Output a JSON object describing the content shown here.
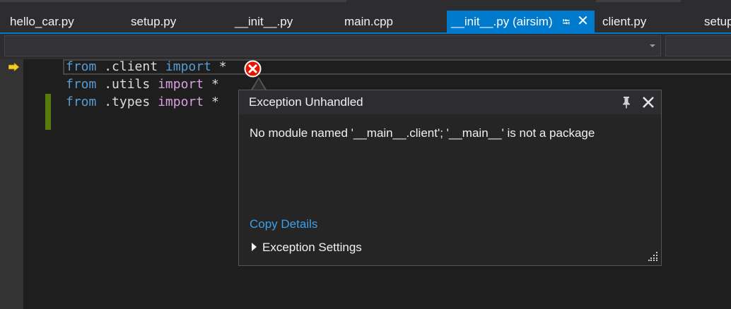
{
  "tabs": [
    {
      "label": "hello_car.py",
      "active": false
    },
    {
      "label": "setup.py",
      "active": false
    },
    {
      "label": "__init__.py",
      "active": false
    },
    {
      "label": "main.cpp",
      "active": false
    },
    {
      "label": "__init__.py (airsim)",
      "active": true
    },
    {
      "label": "client.py",
      "active": false
    },
    {
      "label": "setup.py",
      "active": false
    }
  ],
  "code": [
    {
      "keyword": "from",
      "module": ".client",
      "imp": "import",
      "rest": "*"
    },
    {
      "keyword": "from",
      "module": ".utils",
      "imp": "import",
      "rest": "*"
    },
    {
      "keyword": "from",
      "module": ".types",
      "imp": "import",
      "rest": "*"
    }
  ],
  "popup": {
    "title": "Exception Unhandled",
    "message": "No module named '__main__.client'; '__main__' is not a package",
    "copy_details": "Copy Details",
    "settings": "Exception Settings"
  },
  "icons": {
    "tab_pin": "pin-icon",
    "tab_close": "close-icon",
    "execution": "arrow-icon",
    "error": "error-icon",
    "popup_pin": "pin-icon",
    "popup_close": "close-icon",
    "resize": "resize-grip-icon"
  },
  "colors": {
    "accent": "#007acc",
    "keyword": "#569cd6",
    "import_keyword": "#d8a0df",
    "link": "#3e9ee8",
    "error": "#e51400",
    "change_bar": "#587c0c",
    "execution_arrow": "#f2d027"
  }
}
